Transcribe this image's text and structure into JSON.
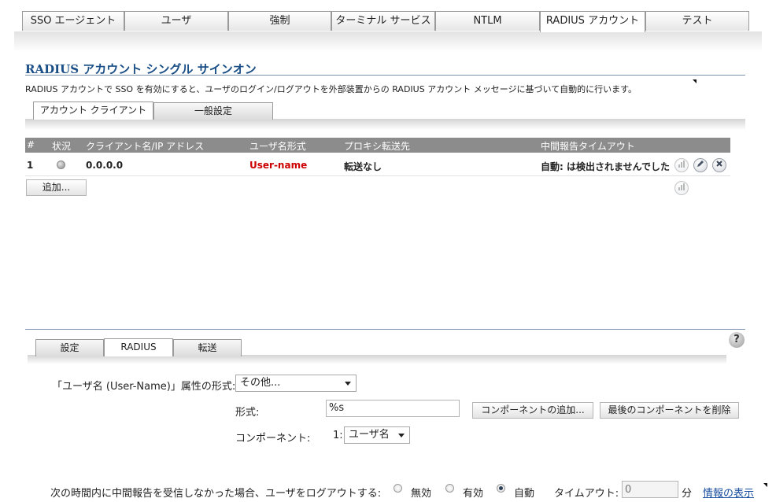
{
  "top_tabs": [
    {
      "label": "SSO エージェント"
    },
    {
      "label": "ユーザ"
    },
    {
      "label": "強制"
    },
    {
      "label": "ターミナル サービス"
    },
    {
      "label": "NTLM"
    },
    {
      "label": "RADIUS アカウント"
    },
    {
      "label": "テスト"
    }
  ],
  "active_top_tab": "RADIUS アカウント",
  "section": {
    "title": "RADIUS アカウント シングル サインオン",
    "description": "RADIUS アカウントで SSO を有効にすると、ユーザのログイン/ログアウトを外部装置からの RADIUS アカウント メッセージに基づいて自動的に行います。"
  },
  "sub_tabs": [
    {
      "label": "アカウント クライアント"
    },
    {
      "label": "一般設定"
    }
  ],
  "table": {
    "headers": [
      "#",
      "状況",
      "クライアント名/IP アドレス",
      "ユーザ名形式",
      "プロキシ転送先",
      "中間報告タイムアウト"
    ],
    "rows": [
      {
        "num": "1",
        "client": "0.0.0.0",
        "user_format": "User-name",
        "proxy": "転送なし",
        "timeout": "自動: は検出されませんでした"
      }
    ],
    "row_icons": [
      "stats-icon",
      "edit-icon",
      "delete-icon"
    ],
    "add_button": "追加..."
  },
  "bottom_tabs": [
    {
      "label": "設定"
    },
    {
      "label": "RADIUS"
    },
    {
      "label": "転送"
    }
  ],
  "radius": {
    "username_attr_label": "「ユーザ名 (User-Name)」属性の形式:",
    "username_attr_value": "その他...",
    "format_label": "形式:",
    "format_value": "%s",
    "add_component_button": "コンポーネントの追加...",
    "remove_component_button": "最後のコンポーネントを削除",
    "component_label": "コンポーネント:",
    "component_index": "1:",
    "component_value": "ユーザ名"
  },
  "logout": {
    "label": "次の時間内に中間報告を受信しなかった場合、ユーザをログアウトする:",
    "options": [
      "無効",
      "有効",
      "自動"
    ],
    "selected": "自動",
    "timeout_label": "タイムアウト:",
    "timeout_placeholder": "0",
    "unit": "分",
    "info_link": "情報の表示"
  },
  "colors": {
    "title": "#1a4e86",
    "user_format": "#cc0000",
    "table_header": "#8c8c8c",
    "link": "#1b4fa0"
  }
}
